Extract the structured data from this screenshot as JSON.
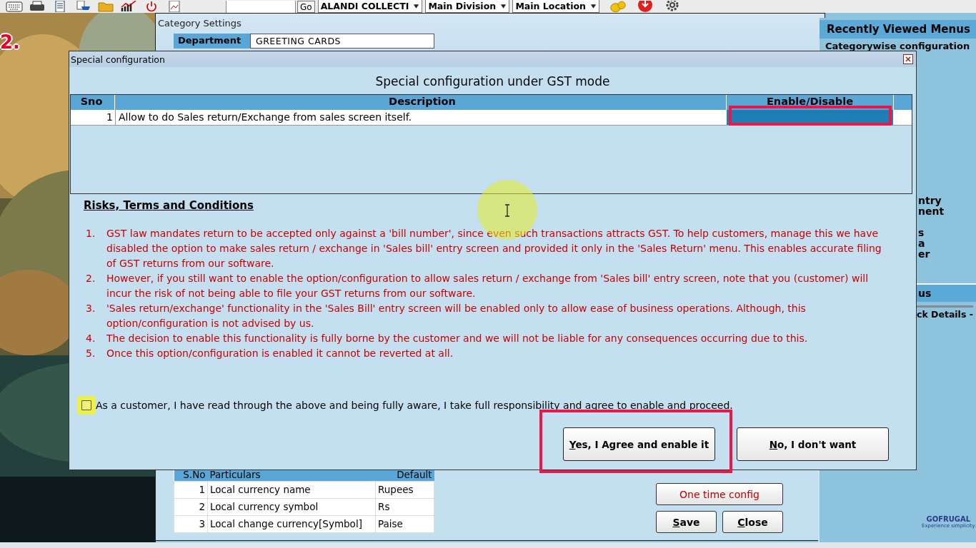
{
  "toolbar": {
    "go_button": "Go",
    "dropdowns": [
      "ALANDI COLLECTI",
      "Main Division",
      "Main Location"
    ]
  },
  "step_label": "2.",
  "category_window": {
    "title": "Category Settings",
    "department_label": "Department",
    "department_value": "GREETING CARDS",
    "table": {
      "columns": [
        "S.No",
        "Particulars",
        "Default"
      ],
      "rows": [
        [
          "1",
          "Local currency name",
          "Rupees"
        ],
        [
          "2",
          "Local currency symbol",
          "Rs"
        ],
        [
          "3",
          "Local change currency[Symbol]",
          "Paise"
        ]
      ]
    },
    "buttons": [
      {
        "label": "One time config",
        "kind": "accent",
        "mnemonic": false
      },
      {
        "label": "Save",
        "kind": "plain",
        "mnemonic": true
      },
      {
        "label": "Close",
        "kind": "plain",
        "mnemonic": true
      }
    ]
  },
  "right_panel": {
    "title": "Recently Viewed Menus",
    "items": [
      "Categorywise configuration"
    ],
    "fragments": [
      "ntry",
      "nent",
      "s",
      "a",
      "er"
    ],
    "section_title": "us",
    "section_items": [
      "ck Details -"
    ],
    "logo": "GOFRUGAL",
    "tagline": "Experience simplicity"
  },
  "dialog": {
    "title": "Special configuration",
    "heading": "Special configuration under GST mode",
    "table": {
      "columns": [
        "Sno",
        "Description",
        "Enable/Disable"
      ],
      "rows": [
        {
          "sno": "1",
          "description": "Allow to do Sales return/Exchange from sales screen itself.",
          "selected": true
        }
      ]
    },
    "terms_title": "Risks, Terms and Conditions",
    "terms": [
      {
        "number": "1.",
        "text": "GST law mandates return to be accepted only against a 'bill number', since even such transactions attracts GST. To help customers, manage this we have disabled the option to make sales return / exchange in 'Sales bill' entry screen and provided it only in the 'Sales Return' menu. This enables accurate filing of GST returns from our software."
      },
      {
        "number": "2.",
        "text": "However, if you still want to enable the option/configuration to allow sales return / exchange from 'Sales bill' entry screen, note that you (customer) will incur the risk of not being able to file your GST returns from our software."
      },
      {
        "number": "3.",
        "text": "'Sales return/exchange' functionality in the 'Sales Bill' entry screen will be enabled only to allow ease of business operations. Although, this option/configuration is not advised by us."
      },
      {
        "number": "4.",
        "text": "The decision to enable this functionality is fully borne by the customer and we will not be liable for any consequences occurring due to this."
      },
      {
        "number": "5.",
        "text": "Once this option/configuration is enabled it cannot be reverted at all."
      }
    ],
    "agree": {
      "label": "As a customer, I have read through the above and being fully aware, I take full responsibility and agree to enable and proceed.",
      "checked": false
    },
    "buttons": [
      {
        "label": "Yes, I Agree and enable it",
        "mnemonic": true
      },
      {
        "label": "No, I don't want",
        "mnemonic": true
      }
    ]
  }
}
